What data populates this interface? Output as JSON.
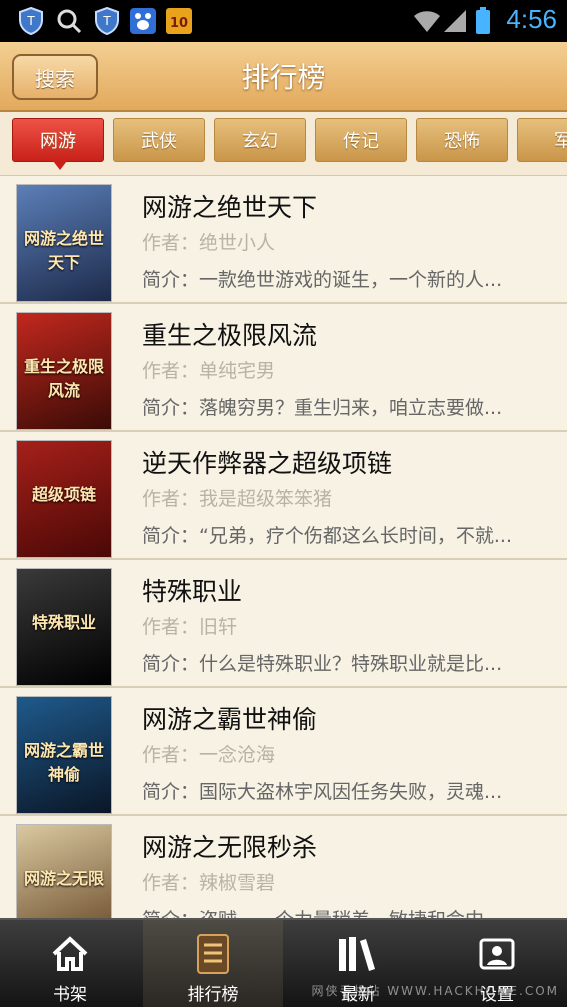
{
  "status_bar": {
    "time": "4:56",
    "icons": [
      "shield-icon",
      "search-icon",
      "shield-icon",
      "baidu-paw-icon",
      "app-icon",
      "wifi-icon",
      "signal-icon",
      "battery-icon"
    ]
  },
  "header": {
    "search_label": "搜索",
    "title": "排行榜"
  },
  "tabs": [
    {
      "label": "网游",
      "active": true
    },
    {
      "label": "武侠",
      "active": false
    },
    {
      "label": "玄幻",
      "active": false
    },
    {
      "label": "传记",
      "active": false
    },
    {
      "label": "恐怖",
      "active": false
    },
    {
      "label": "军",
      "active": false
    }
  ],
  "books": [
    {
      "title": "网游之绝世天下",
      "author_prefix": "作者：",
      "author": "绝世小人",
      "intro_prefix": "简介：",
      "intro": "一款绝世游戏的诞生，一个新的人...",
      "cover_text": "网游之绝世天下",
      "cover_colors": [
        "#5b7fb8",
        "#1d2a4a"
      ]
    },
    {
      "title": "重生之极限风流",
      "author_prefix": "作者：",
      "author": "单纯宅男",
      "intro_prefix": "简介：",
      "intro": "落魄穷男？重生归来，咱立志要做...",
      "cover_text": "重生之极限风流",
      "cover_colors": [
        "#c2281e",
        "#3a0b06"
      ]
    },
    {
      "title": "逆天作弊器之超级项链",
      "author_prefix": "作者：",
      "author": "我是超级笨笨猪",
      "intro_prefix": "简介：",
      "intro": "“兄弟，疗个伤都这么长时间，不就...",
      "cover_text": "超级项链",
      "cover_colors": [
        "#a6201a",
        "#4a0806"
      ]
    },
    {
      "title": "特殊职业",
      "author_prefix": "作者：",
      "author": "旧轩",
      "intro_prefix": "简介：",
      "intro": "什么是特殊职业？特殊职业就是比...",
      "cover_text": "特殊职业",
      "cover_colors": [
        "#2a2a2a",
        "#000000"
      ]
    },
    {
      "title": "网游之霸世神偷",
      "author_prefix": "作者：",
      "author": "一念沧海",
      "intro_prefix": "简介：",
      "intro": "国际大盗林宇风因任务失败，灵魂...",
      "cover_text": "网游之霸世神偷",
      "cover_colors": [
        "#1f5a8c",
        "#0a1626"
      ]
    },
    {
      "title": "网游之无限秒杀",
      "author_prefix": "作者：",
      "author": "辣椒雪碧",
      "intro_prefix": "简介：",
      "intro": "盗贼，一个力量稍差，敏捷和命中...",
      "cover_text": "网游之无限",
      "cover_colors": [
        "#d9c9a0",
        "#6a4a2a"
      ]
    }
  ],
  "bottom_nav": [
    {
      "label": "书架",
      "icon": "home-icon",
      "active": false
    },
    {
      "label": "排行榜",
      "icon": "list-book-icon",
      "active": true
    },
    {
      "label": "最新",
      "icon": "books-icon",
      "active": false
    },
    {
      "label": "设置",
      "icon": "settings-icon",
      "active": false
    }
  ],
  "watermark": "网侠手机站 WWW.HACKHOME.COM"
}
